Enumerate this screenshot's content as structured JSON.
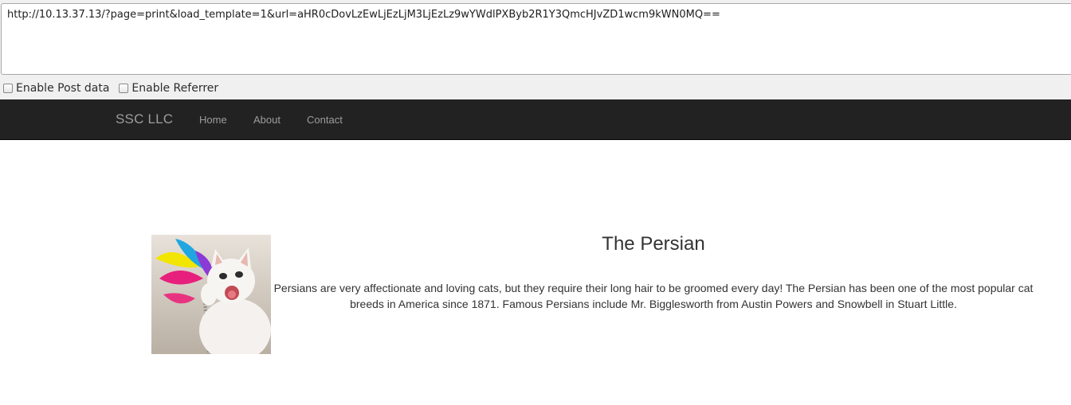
{
  "url_bar": {
    "value": "http://10.13.37.13/?page=print&load_template=1&url=aHR0cDovLzEwLjEzLjM3LjEzLz9wYWdlPXByb2R1Y3QmcHJvZD1wcm9kWN0MQ=="
  },
  "options": {
    "post_label": "Enable Post data",
    "referrer_label": "Enable Referrer"
  },
  "navbar": {
    "brand": "SSC LLC",
    "links": [
      "Home",
      "About",
      "Contact"
    ]
  },
  "product": {
    "title": "The Persian",
    "description": "Persians are very affectionate and loving cats, but they require their long hair to be groomed every day! The Persian has been one of the most popular cat breeds in America since 1871. Famous Persians include Mr. Bigglesworth from Austin Powers and Snowbell in Stuart Little."
  }
}
